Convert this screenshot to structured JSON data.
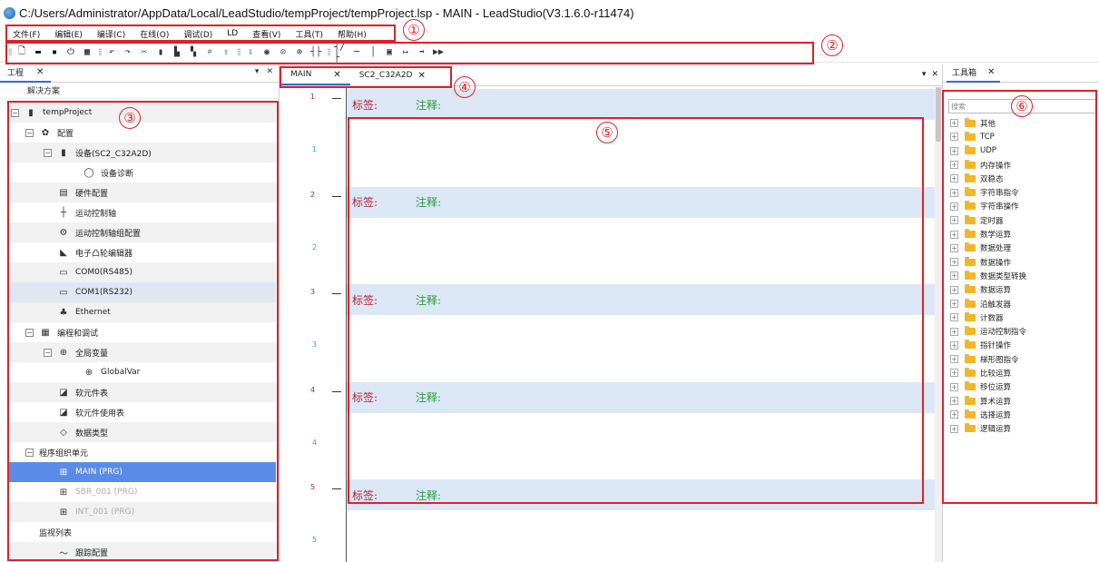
{
  "window": {
    "title": "C:/Users/Administrator/AppData/Local/LeadStudio/tempProject/tempProject.lsp - MAIN - LeadStudio(V3.1.6.0-r11474)"
  },
  "menu": [
    "文件(F)",
    "编辑(E)",
    "编译(C)",
    "在线(O)",
    "调试(D)",
    "LD",
    "查看(V)",
    "工具(T)",
    "帮助(H)"
  ],
  "toolbar_icons": [
    "new-file-icon",
    "open-folder-icon",
    "save-icon",
    "power-icon",
    "build-icon",
    "undo-icon",
    "redo-icon",
    "cut-icon",
    "copy-icon",
    "paste-icon",
    "save-all-icon",
    "find-icon",
    "upload-icon",
    "download-icon",
    "monitor-icon",
    "coil-icon",
    "coil-set-icon",
    "contact-no-icon",
    "contact-nc-icon",
    "line-icon",
    "branch-icon",
    "function-block-icon",
    "jump-icon",
    "arrow-right-icon",
    "run-icon"
  ],
  "project_panel": {
    "tab_label": "工程",
    "solution_label": "解决方案",
    "tree": [
      {
        "label": "tempProject",
        "level": 0,
        "toggle": "−",
        "icon": "project-icon"
      },
      {
        "label": "配置",
        "level": 1,
        "toggle": "−",
        "icon": "gear-icon"
      },
      {
        "label": "设备(SC2_C32A2D)",
        "level": 2,
        "toggle": "−",
        "icon": "device-icon"
      },
      {
        "label": "设备诊断",
        "level": 3,
        "toggle": "",
        "icon": "search-icon"
      },
      {
        "label": "硬件配置",
        "level": 2,
        "toggle": "",
        "icon": "hardware-icon"
      },
      {
        "label": "运动控制轴",
        "level": 2,
        "toggle": "",
        "icon": "axis-icon"
      },
      {
        "label": "运动控制轴组配置",
        "level": 2,
        "toggle": "",
        "icon": "axis-group-icon"
      },
      {
        "label": "电子凸轮编辑器",
        "level": 2,
        "toggle": "",
        "icon": "cam-icon"
      },
      {
        "label": "COM0(RS485)",
        "level": 2,
        "toggle": "",
        "icon": "serial-port-icon"
      },
      {
        "label": "COM1(RS232)",
        "level": 2,
        "toggle": "",
        "icon": "serial-port-icon"
      },
      {
        "label": "Ethernet",
        "level": 2,
        "toggle": "",
        "icon": "network-icon"
      },
      {
        "label": "编程和调试",
        "level": 1,
        "toggle": "−",
        "icon": "program-icon"
      },
      {
        "label": "全局变量",
        "level": 2,
        "toggle": "−",
        "icon": "globe-icon"
      },
      {
        "label": "GlobalVar",
        "level": 3,
        "toggle": "",
        "icon": "globe-icon"
      },
      {
        "label": "软元件表",
        "level": 2,
        "toggle": "",
        "icon": "table-icon"
      },
      {
        "label": "软元件使用表",
        "level": 2,
        "toggle": "",
        "icon": "table-icon"
      },
      {
        "label": "数据类型",
        "level": 2,
        "toggle": "",
        "icon": "datatype-icon"
      },
      {
        "label": "程序组织单元",
        "level": 1,
        "toggle": "−",
        "icon": ""
      },
      {
        "label": "MAIN (PRG)",
        "level": 2,
        "toggle": "",
        "icon": "ladder-program-icon"
      },
      {
        "label": "SBR_001 (PRG)",
        "level": 2,
        "toggle": "",
        "icon": "ladder-program-icon"
      },
      {
        "label": "INT_001 (PRG)",
        "level": 2,
        "toggle": "",
        "icon": "ladder-program-icon"
      },
      {
        "label": "监视列表",
        "level": 1,
        "toggle": "",
        "icon": ""
      },
      {
        "label": "跟踪配置",
        "level": 2,
        "toggle": "",
        "icon": "trace-icon"
      }
    ]
  },
  "editor": {
    "tabs": [
      {
        "label": "MAIN"
      },
      {
        "label": "SC2_C32A2D"
      }
    ],
    "rungs": [
      {
        "num": "1",
        "sub": "1",
        "label_text": "标签:",
        "comment_text": "注释:"
      },
      {
        "num": "2",
        "sub": "2",
        "label_text": "标签:",
        "comment_text": "注释:"
      },
      {
        "num": "3",
        "sub": "3",
        "label_text": "标签:",
        "comment_text": "注释:"
      },
      {
        "num": "4",
        "sub": "4",
        "label_text": "标签:",
        "comment_text": "注释:"
      },
      {
        "num": "5",
        "sub": "5",
        "label_text": "标签:",
        "comment_text": "注释:"
      }
    ]
  },
  "toolbox": {
    "tab_label": "工具箱",
    "search_placeholder": "搜索",
    "items": [
      "其他",
      "TCP",
      "UDP",
      "内存操作",
      "双稳态",
      "字符串指令",
      "字符串操作",
      "定时器",
      "数学运算",
      "数据处理",
      "数据操作",
      "数据类型转换",
      "数据运算",
      "沿触发器",
      "计数器",
      "运动控制指令",
      "指针操作",
      "梯形图指令",
      "比较运算",
      "移位运算",
      "算术运算",
      "选择运算",
      "逻辑运算"
    ]
  },
  "annotations": [
    "①",
    "②",
    "③",
    "④",
    "⑤",
    "⑥"
  ],
  "colors": {
    "accent": "#2f6fcf",
    "selection": "#5b8be8",
    "rung_header": "#dce7f6",
    "label_red": "#b0232f",
    "comment_green": "#2a9a3c",
    "annotation_red": "#e0202a",
    "folder": "#f2b62c"
  }
}
